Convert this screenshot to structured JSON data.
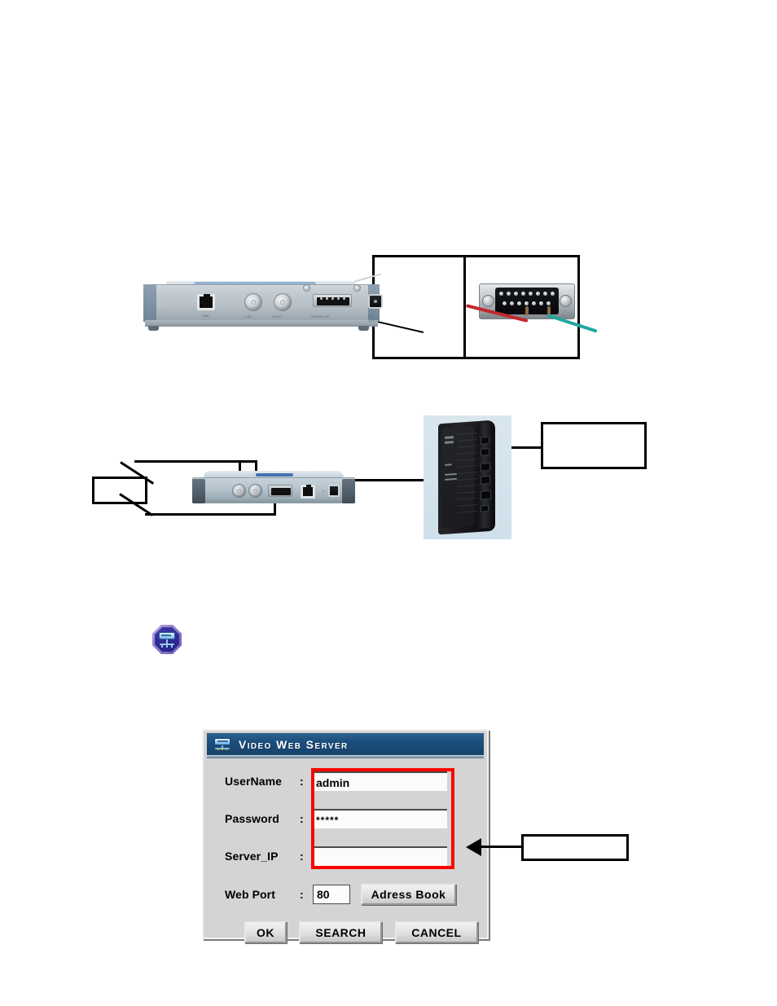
{
  "document": {
    "type": "scanned-manual-page",
    "page_background": "#ffffff"
  },
  "figures": [
    {
      "name": "rear-panel-alarm-wiring",
      "description": "Video Web Server rear panel photo with a magnified D-Sub connector close-up",
      "callouts": [
        {
          "name": "dsub-callout-box",
          "text": ""
        }
      ],
      "photos": [
        {
          "name": "device-rear-panel-photo",
          "ports": [
            "lan",
            "video-in",
            "video-out",
            "alarm-io",
            "dc-in"
          ]
        },
        {
          "name": "dsub-connector-closeup-photo",
          "wires": [
            "#c3282d",
            "#1fa7a0"
          ]
        }
      ]
    },
    {
      "name": "rear-panel-network-connection",
      "description": "Video Web Server rear panel photo connected to a router/hub photo",
      "callouts": [
        {
          "name": "left-callout-box",
          "text": ""
        },
        {
          "name": "right-callout-box",
          "text": ""
        }
      ],
      "photos": [
        {
          "name": "device-rear-panel-photo-2",
          "ports": [
            "video-in",
            "video-out",
            "rs232",
            "lan",
            "dc-in"
          ]
        },
        {
          "name": "router-hub-photo"
        }
      ]
    }
  ],
  "note_icon": {
    "name": "note-octagon-icon",
    "shape": "octagon",
    "colors": {
      "outer": "#8f7cc9",
      "inner": "#2d2d96",
      "glyph": "#bcd9f5"
    }
  },
  "dialog": {
    "title": "Video Web Server",
    "title_icon": "server-device-icon",
    "colors": {
      "titlebar": "#1d4e7c",
      "body": "#d4d4d4",
      "highlight": "#ff0000"
    },
    "fields": [
      {
        "label": "UserName",
        "colon": ":",
        "value": "admin",
        "placeholder": ""
      },
      {
        "label": "Password",
        "colon": ":",
        "value": "*****",
        "placeholder": ""
      },
      {
        "label": "Server_IP",
        "colon": ":",
        "value": "",
        "placeholder": ""
      }
    ],
    "port_row": {
      "label": "Web Port",
      "colon": ":",
      "value": "80",
      "placeholder": "",
      "address_book_label": "Adress Book"
    },
    "buttons": [
      {
        "name": "ok",
        "label": "OK"
      },
      {
        "name": "search",
        "label": "SEARCH"
      },
      {
        "name": "cancel",
        "label": "CANCEL"
      }
    ],
    "annotation": {
      "name": "server-ip-callout-box",
      "text": "",
      "arrow": "points-left-to-fields"
    }
  }
}
